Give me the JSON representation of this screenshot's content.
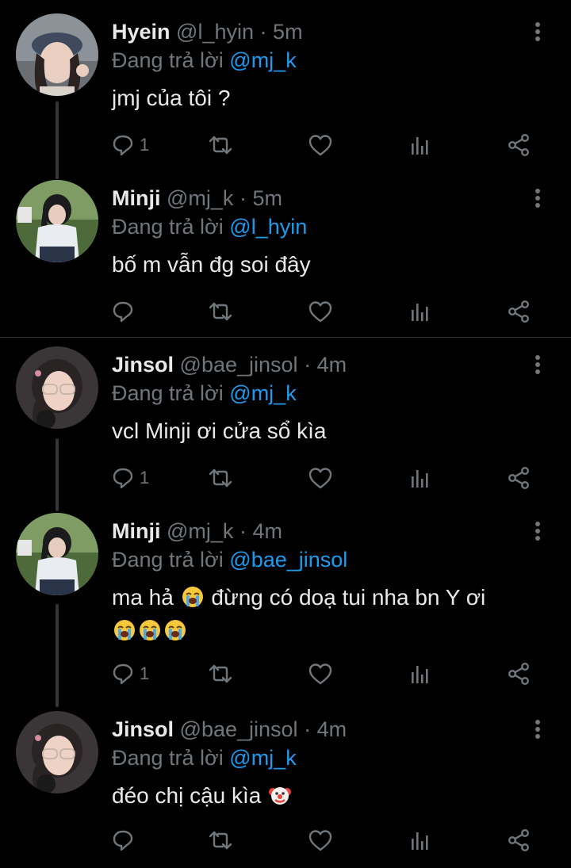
{
  "tweets": [
    {
      "name": "Hyein",
      "handle": "@l_hyin",
      "time": "5m",
      "replying_prefix": "Đang trả lời",
      "replying_to": "@mj_k",
      "text": "jmj của tôi ?",
      "reply_count": "1"
    },
    {
      "name": "Minji",
      "handle": "@mj_k",
      "time": "5m",
      "replying_prefix": "Đang trả lời",
      "replying_to": "@l_hyin",
      "text": "bố m vẫn đg soi đây",
      "reply_count": ""
    },
    {
      "name": "Jinsol",
      "handle": "@bae_jinsol",
      "time": "4m",
      "replying_prefix": "Đang trả lời",
      "replying_to": "@mj_k",
      "text": "vcl Minji ơi cửa sổ kìa",
      "reply_count": "1"
    },
    {
      "name": "Minji",
      "handle": "@mj_k",
      "time": "4m",
      "replying_prefix": "Đang trả lời",
      "replying_to": "@bae_jinsol",
      "text_part1": "ma hả",
      "text_part2": "đừng có doạ tui nha bn Y ơi",
      "reply_count": "1"
    },
    {
      "name": "Jinsol",
      "handle": "@bae_jinsol",
      "time": "4m",
      "replying_prefix": "Đang trả lời",
      "replying_to": "@mj_k",
      "text": "đéo chị cậu kìa",
      "reply_count": ""
    }
  ],
  "separator": "·",
  "icons": {
    "reply": "reply-icon",
    "retweet": "retweet-icon",
    "like": "heart-icon",
    "views": "views-chart-icon",
    "share": "share-icon",
    "more": "more-vertical-icon",
    "crying": "loudly-crying-face-emoji",
    "clown": "clown-face-emoji"
  },
  "colors": {
    "background": "#000000",
    "text": "#e7e9ea",
    "muted": "#71767b",
    "accent": "#1d9bf0",
    "divider": "#2f3336"
  }
}
